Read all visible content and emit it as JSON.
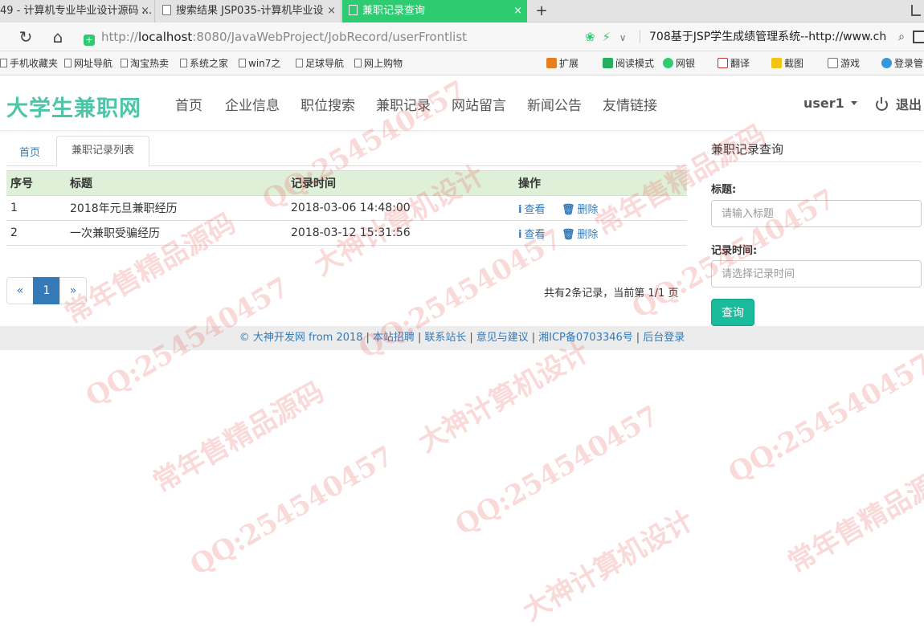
{
  "browser": {
    "tabs": [
      {
        "label": "49 - 计算机专业毕业设计源码 ...",
        "active": false
      },
      {
        "label": "搜索结果 JSP035-计算机毕业设",
        "active": false
      },
      {
        "label": "兼职记录查询",
        "active": true
      }
    ],
    "close_glyph": "×",
    "new_tab_glyph": "+",
    "url_prefix": "http://",
    "url_host": "localhost",
    "url_rest": ":8080/JavaWebProject/JobRecord/userFrontlist",
    "search_text": "708基于JSP学生成绩管理系统--http://www.ch",
    "bookmarks": [
      "手机收藏夹",
      "网址导航",
      "淘宝热卖",
      "系统之家",
      "win7之",
      "足球导航",
      "网上购物"
    ],
    "extensions": [
      "扩展",
      "阅读模式",
      "网银",
      "翻译",
      "截图",
      "游戏",
      "登录管"
    ],
    "accent": "#2ecc71"
  },
  "site": {
    "brand": "大学生兼职网",
    "nav": [
      "首页",
      "企业信息",
      "职位搜索",
      "兼职记录",
      "网站留言",
      "新闻公告",
      "友情链接"
    ],
    "user": "user1",
    "logout": "退出",
    "brand_color": "#4fc5a8"
  },
  "breadcrumb": {
    "home": "首页",
    "current": "兼职记录列表"
  },
  "table": {
    "headers": [
      "序号",
      "标题",
      "记录时间",
      "操作"
    ],
    "rows": [
      {
        "no": "1",
        "title": "2018年元旦兼职经历",
        "time": "2018-03-06 14:48:00"
      },
      {
        "no": "2",
        "title": "一次兼职受骗经历",
        "time": "2018-03-12 15:31:56"
      }
    ],
    "view_label": "查看",
    "delete_label": "删除"
  },
  "pagination": {
    "prev": "«",
    "current": "1",
    "next": "»",
    "info": "共有2条记录，当前第 1/1 页"
  },
  "sidebar": {
    "title": "兼职记录查询",
    "title_label": "标题:",
    "title_placeholder": "请输入标题",
    "time_label": "记录时间:",
    "time_placeholder": "请选择记录时间",
    "query_button": "查询"
  },
  "footer": {
    "copyright": "© 大神开发网 from 2018",
    "links": [
      "本站招聘",
      "联系站长",
      "意见与建议",
      "湘ICP备0703346号",
      "后台登录"
    ],
    "separator": "|"
  },
  "watermark": {
    "qq": "QQ:25454045 7",
    "qq_full": "QQ:254540457",
    "shop": "常年售精品源码",
    "design": "大神计算机设计"
  }
}
